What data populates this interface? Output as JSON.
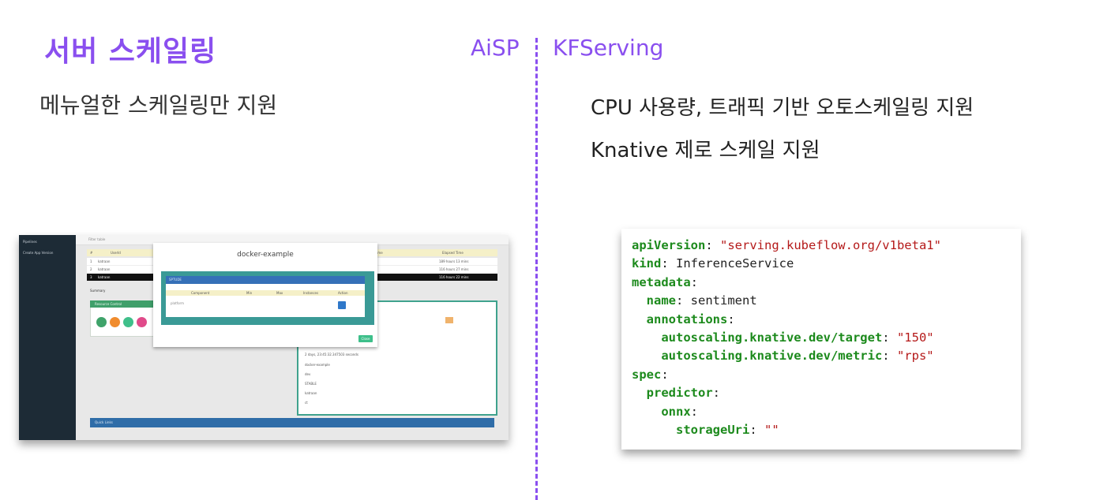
{
  "slide": {
    "title": "서버 스케일링",
    "left_label": "AiSP",
    "right_label": "KFServing",
    "left_description": "메뉴얼한 스케일링만 지원",
    "right_descriptions": [
      "CPU 사용량, 트래픽 기반 오토스케일링 지원",
      "Knative 제로 스케일 지원"
    ]
  },
  "screenshot": {
    "sidebar_items": [
      "Pipelines",
      "Create App Version"
    ],
    "filter_placeholder": "Filter table",
    "table_headers": [
      "#",
      "UserId",
      "End Time",
      "Elapsed Time"
    ],
    "table_rows": [
      {
        "num": "1",
        "user": "katraan",
        "elapsed": "189 hours 13 mins"
      },
      {
        "num": "2",
        "user": "katraan",
        "elapsed": "116 hours 27 mins"
      },
      {
        "num": "3",
        "user": "katraan",
        "elapsed": "116 hours 22 mins"
      }
    ],
    "summary_label": "Summary",
    "panel_title": "Resource Control",
    "detail_values": [
      "2 days, 23:45:32.347503 seconds",
      "docker-example",
      "dev",
      "STABLE",
      "katraan",
      "ct"
    ],
    "quick_links_label": "Quick Links",
    "modal": {
      "title": "docker-example",
      "inner_header": "SPTUDE",
      "columns": [
        "Component",
        "Min",
        "Max",
        "Instances",
        "Action"
      ],
      "row_component": "platform",
      "close_label": "Close"
    }
  },
  "code": {
    "lines": [
      {
        "indent": 0,
        "key": "apiVersion",
        "sep": ": ",
        "value": "\"serving.kubeflow.org/v1beta1\"",
        "value_type": "string"
      },
      {
        "indent": 0,
        "key": "kind",
        "sep": ": ",
        "value": "InferenceService",
        "value_type": "plain"
      },
      {
        "indent": 0,
        "key": "metadata",
        "sep": ":",
        "value": "",
        "value_type": "plain"
      },
      {
        "indent": 1,
        "key": "name",
        "sep": ": ",
        "value": "sentiment",
        "value_type": "plain"
      },
      {
        "indent": 1,
        "key": "annotations",
        "sep": ":",
        "value": "",
        "value_type": "plain"
      },
      {
        "indent": 2,
        "key": "autoscaling.knative.dev/target",
        "sep": ": ",
        "value": "\"150\"",
        "value_type": "string"
      },
      {
        "indent": 2,
        "key": "autoscaling.knative.dev/metric",
        "sep": ": ",
        "value": "\"rps\"",
        "value_type": "string"
      },
      {
        "indent": 0,
        "key": "spec",
        "sep": ":",
        "value": "",
        "value_type": "plain"
      },
      {
        "indent": 1,
        "key": "predictor",
        "sep": ":",
        "value": "",
        "value_type": "plain"
      },
      {
        "indent": 2,
        "key": "onnx",
        "sep": ":",
        "value": "",
        "value_type": "plain"
      },
      {
        "indent": 3,
        "key": "storageUri",
        "sep": ": ",
        "value": "\"\"",
        "value_type": "string"
      }
    ]
  },
  "colors": {
    "accent": "#8a4fef",
    "code_key": "#1c8a1c",
    "code_string": "#b51a1a",
    "teal": "#3a9a96"
  }
}
